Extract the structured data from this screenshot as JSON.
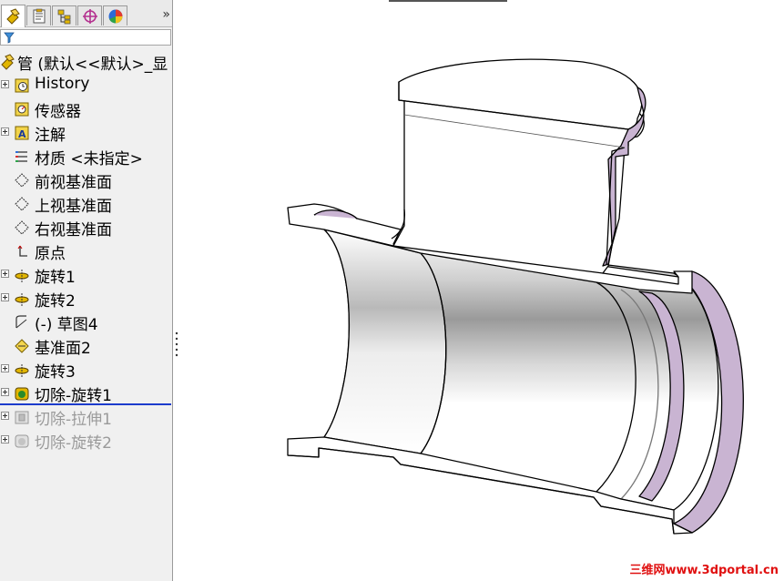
{
  "tabs": [
    {
      "icon": "feature-manager-icon"
    },
    {
      "icon": "property-manager-icon"
    },
    {
      "icon": "configuration-manager-icon"
    },
    {
      "icon": "dimxpert-manager-icon"
    },
    {
      "icon": "display-manager-icon"
    }
  ],
  "tabs_more": "»",
  "tree": {
    "root": "管  (默认<<默认>_显",
    "items": [
      {
        "label": "History",
        "icon": "history-icon"
      },
      {
        "label": "传感器",
        "icon": "sensor-icon"
      },
      {
        "label": "注解",
        "icon": "annotation-icon"
      },
      {
        "label": "材质 <未指定>",
        "icon": "material-icon"
      },
      {
        "label": "前视基准面",
        "icon": "plane-icon"
      },
      {
        "label": "上视基准面",
        "icon": "plane-icon"
      },
      {
        "label": "右视基准面",
        "icon": "plane-icon"
      },
      {
        "label": "原点",
        "icon": "origin-icon"
      },
      {
        "label": "旋转1",
        "icon": "revolve-icon"
      },
      {
        "label": "旋转2",
        "icon": "revolve-icon"
      },
      {
        "label": "(-) 草图4",
        "icon": "sketch-icon"
      },
      {
        "label": "基准面2",
        "icon": "plane-icon"
      },
      {
        "label": "旋转3",
        "icon": "revolve-icon"
      },
      {
        "label": "切除-旋转1",
        "icon": "cut-revolve-icon"
      },
      {
        "label": "切除-拉伸1",
        "icon": "cut-extrude-icon"
      },
      {
        "label": "切除-旋转2",
        "icon": "cut-revolve-icon"
      }
    ]
  },
  "watermark": "三维网www.3dportal.cn",
  "colors": {
    "rollback_bar": "#1c3ccc",
    "section_face": "#c9b4d2",
    "watermark": "#e01010"
  }
}
